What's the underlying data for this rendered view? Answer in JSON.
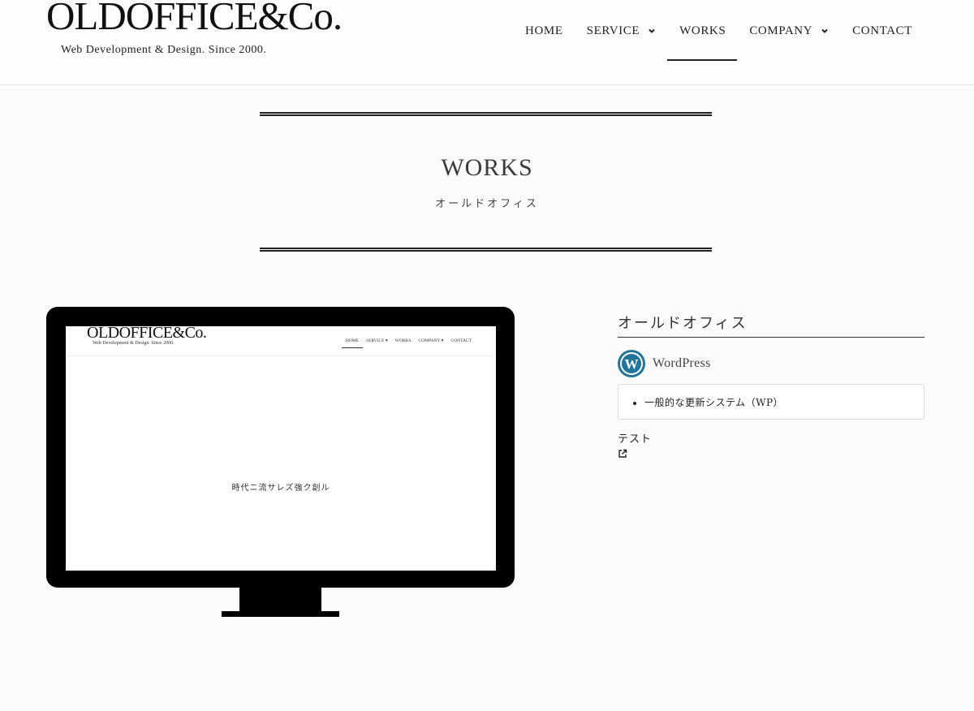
{
  "header": {
    "logo": "OLDOFFICE&Co.",
    "tagline": "Web Development & Design. Since 2000.",
    "nav": [
      {
        "label": "HOME"
      },
      {
        "label": "SERVICE"
      },
      {
        "label": "WORKS"
      },
      {
        "label": "COMPANY"
      },
      {
        "label": "CONTACT"
      }
    ]
  },
  "hero": {
    "title": "WORKS",
    "subtitle": "オールドオフィス"
  },
  "preview": {
    "logo": "OLDOFFICE&Co.",
    "tagline": "Web Development & Design. Since 2000.",
    "nav": [
      "HOME",
      "SERVICE ▾",
      "WORKS",
      "COMPANY ▾",
      "CONTACT"
    ],
    "catchphrase": "時代ニ流サレズ強ク創ル"
  },
  "work": {
    "title": "オールドオフィス",
    "platform": "WordPress",
    "features": [
      "一般的な更新システム（WP）"
    ],
    "note": "テスト"
  },
  "colors": {
    "background": "#fcfbf9",
    "text": "#333333",
    "wordpress_blue": "#21759b",
    "monitor": "#000000"
  }
}
